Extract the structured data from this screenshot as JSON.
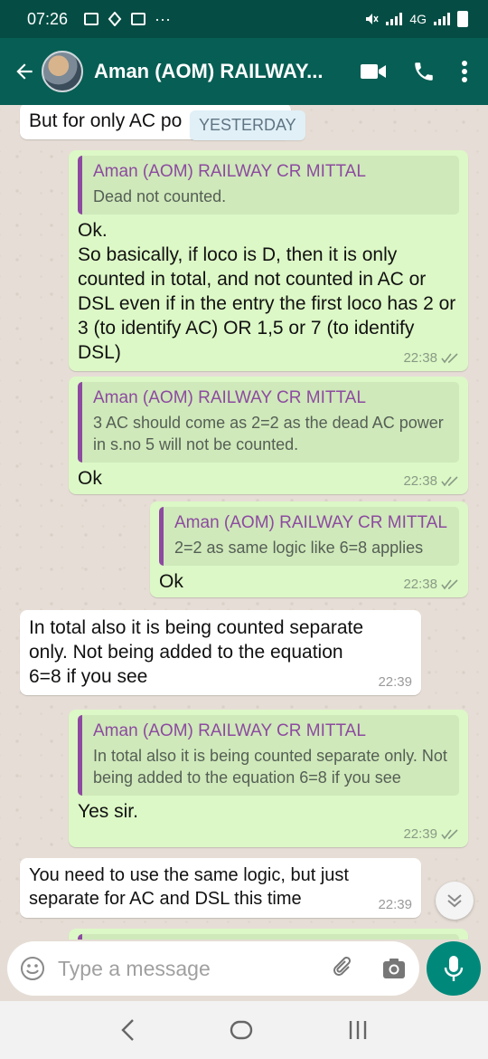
{
  "status_bar": {
    "time": "07:26",
    "network": "4G",
    "dots": "···"
  },
  "header": {
    "contact_name": "Aman (AOM) RAILWAY..."
  },
  "chat": {
    "date_chip": "YESTERDAY",
    "first_partial": "But for only AC po",
    "messages": [
      {
        "direction": "out",
        "quote_name": "Aman (AOM) RAILWAY CR MITTAL",
        "quote_text": "Dead not counted.",
        "text": "Ok.\nSo basically, if loco is D, then it is only counted in total, and not counted in AC or DSL even if in the entry the first loco has 2 or 3 (to identify AC) OR 1,5 or 7 (to identify DSL)",
        "time": "22:38"
      },
      {
        "direction": "out",
        "quote_name": "Aman (AOM) RAILWAY CR MITTAL",
        "quote_text": "3 AC should come as 2=2 as the dead AC power in s.no 5 will not be counted.",
        "text": "Ok",
        "time": "22:38"
      },
      {
        "direction": "out",
        "quote_name": "Aman (AOM) RAILWAY CR MITTAL",
        "quote_text": "2=2 as same logic like 6=8 applies",
        "text": "Ok",
        "time": "22:38"
      },
      {
        "direction": "in",
        "text": "In total also it is being counted separate only. Not being added to the equation 6=8 if you see",
        "time": "22:39"
      },
      {
        "direction": "out",
        "quote_name": "Aman (AOM) RAILWAY CR MITTAL",
        "quote_text": "In total also it is being counted separate only. Not being added to the equation 6=8 if you see",
        "text": "Yes sir.",
        "time": "22:39"
      },
      {
        "direction": "in",
        "text": "You need to use the same logic, but just separate for AC and DSL this time",
        "time": "22:39"
      }
    ]
  },
  "input": {
    "placeholder": "Type a message"
  },
  "colors": {
    "header": "#075e54",
    "outgoing_bubble": "#dcf8c6",
    "incoming_bubble": "#ffffff",
    "quote_accent": "#8d4aa0",
    "mic_button": "#00897b"
  },
  "icons": [
    "back-arrow-icon",
    "video-call-icon",
    "phone-icon",
    "more-vert-icon",
    "emoji-icon",
    "attach-icon",
    "camera-icon",
    "mic-icon",
    "double-tick-icon",
    "scroll-down-icon"
  ]
}
